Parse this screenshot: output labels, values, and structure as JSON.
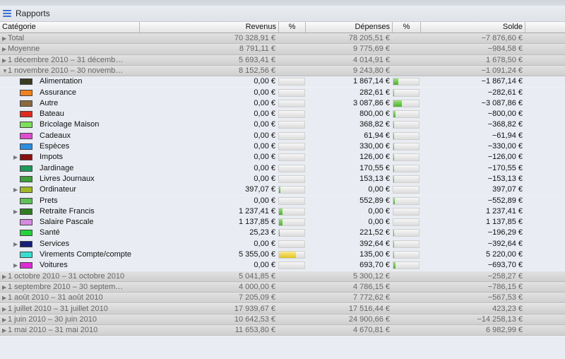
{
  "window": {
    "title": "Rapports"
  },
  "columns": {
    "categorie": "Catégorie",
    "revenus": "Revenus",
    "pct1": "%",
    "depenses": "Dépenses",
    "pct2": "%",
    "solde": "Solde"
  },
  "colors": {
    "bar_green": "#4bb22a",
    "bar_yellow": "#e2c320",
    "accent": "#3a6fd8"
  },
  "rows": [
    {
      "type": "group",
      "expanded": false,
      "label": "Total",
      "revenus": "70 328,91 €",
      "depenses": "78 205,51 €",
      "solde": "−7 876,60 €"
    },
    {
      "type": "group",
      "expanded": false,
      "label": "Moyenne",
      "revenus": "8 791,11 €",
      "depenses": "9 775,69 €",
      "solde": "−984,58 €"
    },
    {
      "type": "group",
      "expanded": false,
      "label": "1 décembre 2010 – 31 décemb…",
      "revenus": "5 693,41 €",
      "depenses": "4 014,91 €",
      "solde": "1 678,50 €"
    },
    {
      "type": "group",
      "expanded": true,
      "label": "1 novembre 2010 – 30 novemb…",
      "revenus": "8 152,56 €",
      "depenses": "9 243,80 €",
      "solde": "−1 091,24 €"
    },
    {
      "type": "sub",
      "label": "Alimentation",
      "color": "#3b3b1f",
      "revenus": "0,00 €",
      "rev_pct": 0,
      "depenses": "1 867,14 €",
      "dep_pct": 20,
      "solde": "−1 867,14 €"
    },
    {
      "type": "sub",
      "label": "Assurance",
      "color": "#f0821e",
      "revenus": "0,00 €",
      "rev_pct": 0,
      "depenses": "282,61 €",
      "dep_pct": 3,
      "solde": "−282,61 €"
    },
    {
      "type": "sub",
      "label": "Autre",
      "color": "#8b6a3e",
      "revenus": "0,00 €",
      "rev_pct": 0,
      "depenses": "3 087,86 €",
      "dep_pct": 33,
      "solde": "−3 087,86 €"
    },
    {
      "type": "sub",
      "label": "Bateau",
      "color": "#e02a1e",
      "revenus": "0,00 €",
      "rev_pct": 0,
      "depenses": "800,00 €",
      "dep_pct": 9,
      "solde": "−800,00 €"
    },
    {
      "type": "sub",
      "label": "Bricolage Maison",
      "color": "#7ee05a",
      "revenus": "0,00 €",
      "rev_pct": 0,
      "depenses": "368,82 €",
      "dep_pct": 4,
      "solde": "−368,82 €"
    },
    {
      "type": "sub",
      "label": "Cadeaux",
      "color": "#e04cd0",
      "revenus": "0,00 €",
      "rev_pct": 0,
      "depenses": "61,94 €",
      "dep_pct": 1,
      "solde": "−61,94 €"
    },
    {
      "type": "sub",
      "label": "Espèces",
      "color": "#2a8fe0",
      "revenus": "0,00 €",
      "rev_pct": 0,
      "depenses": "330,00 €",
      "dep_pct": 4,
      "solde": "−330,00 €"
    },
    {
      "type": "sub",
      "label": "Impots",
      "color": "#8a1010",
      "disclosure": true,
      "revenus": "0,00 €",
      "rev_pct": 0,
      "depenses": "126,00 €",
      "dep_pct": 1,
      "solde": "−126,00 €"
    },
    {
      "type": "sub",
      "label": "Jardinage",
      "color": "#1e9a5a",
      "revenus": "0,00 €",
      "rev_pct": 0,
      "depenses": "170,55 €",
      "dep_pct": 2,
      "solde": "−170,55 €"
    },
    {
      "type": "sub",
      "label": "Livres Journaux",
      "color": "#3fa03a",
      "revenus": "0,00 €",
      "rev_pct": 0,
      "depenses": "153,13 €",
      "dep_pct": 2,
      "solde": "−153,13 €"
    },
    {
      "type": "sub",
      "label": "Ordinateur",
      "color": "#a3b826",
      "disclosure": true,
      "revenus": "397,07 €",
      "rev_pct": 5,
      "depenses": "0,00 €",
      "dep_pct": 0,
      "solde": "397,07 €"
    },
    {
      "type": "sub",
      "label": "Prets",
      "color": "#5fc25a",
      "revenus": "0,00 €",
      "rev_pct": 0,
      "depenses": "552,89 €",
      "dep_pct": 6,
      "solde": "−552,89 €"
    },
    {
      "type": "sub",
      "label": "Retraite Francis",
      "color": "#2f7f1f",
      "disclosure": true,
      "revenus": "1 237,41 €",
      "rev_pct": 15,
      "depenses": "0,00 €",
      "dep_pct": 0,
      "solde": "1 237,41 €"
    },
    {
      "type": "sub",
      "label": "Salaire Pascale",
      "color": "#d48ae0",
      "revenus": "1 137,85 €",
      "rev_pct": 14,
      "depenses": "0,00 €",
      "dep_pct": 0,
      "solde": "1 137,85 €"
    },
    {
      "type": "sub",
      "label": "Santé",
      "color": "#22d43a",
      "revenus": "25,23 €",
      "rev_pct": 0.5,
      "depenses": "221,52 €",
      "dep_pct": 2,
      "solde": "−196,29 €"
    },
    {
      "type": "sub",
      "label": "Services",
      "color": "#14207a",
      "disclosure": true,
      "revenus": "0,00 €",
      "rev_pct": 0,
      "depenses": "392,64 €",
      "dep_pct": 4,
      "solde": "−392,64 €"
    },
    {
      "type": "sub",
      "label": "Virements Compte/compte",
      "color": "#36e0d0",
      "revenus": "5 355,00 €",
      "rev_pct": 66,
      "rev_color": "yellow",
      "depenses": "135,00 €",
      "dep_pct": 1,
      "solde": "5 220,00 €"
    },
    {
      "type": "sub",
      "label": "Voitures",
      "color": "#e02ad8",
      "disclosure": true,
      "revenus": "0,00 €",
      "rev_pct": 0,
      "depenses": "693,70 €",
      "dep_pct": 8,
      "solde": "−693,70 €"
    },
    {
      "type": "group",
      "expanded": false,
      "label": "1 octobre 2010 – 31 octobre 2010",
      "revenus": "5 041,85 €",
      "depenses": "5 300,12 €",
      "solde": "−258,27 €"
    },
    {
      "type": "group",
      "expanded": false,
      "label": "1 septembre 2010 – 30 septem…",
      "revenus": "4 000,00 €",
      "depenses": "4 786,15 €",
      "solde": "−786,15 €"
    },
    {
      "type": "group",
      "expanded": false,
      "label": "1 août 2010 – 31 août 2010",
      "revenus": "7 205,09 €",
      "depenses": "7 772,62 €",
      "solde": "−567,53 €"
    },
    {
      "type": "group",
      "expanded": false,
      "label": "1 juillet 2010 – 31 juillet 2010",
      "revenus": "17 939,67 €",
      "depenses": "17 516,44 €",
      "solde": "423,23 €"
    },
    {
      "type": "group",
      "expanded": false,
      "label": "1 juin 2010 – 30 juin 2010",
      "revenus": "10 642,53 €",
      "depenses": "24 900,66 €",
      "solde": "−14 258,13 €"
    },
    {
      "type": "group",
      "expanded": false,
      "label": "1 mai 2010 – 31 mai 2010",
      "revenus": "11 653,80 €",
      "depenses": "4 670,81 €",
      "solde": "6 982,99 €"
    }
  ]
}
